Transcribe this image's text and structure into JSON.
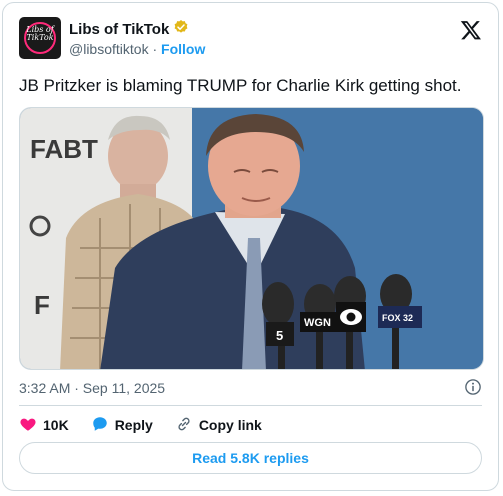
{
  "author": {
    "display_name": "Libs of TikTok",
    "handle": "@libsoftiktok",
    "separator": "·",
    "follow_label": "Follow",
    "avatar_text": "Libs of TikTok"
  },
  "tweet": {
    "text": "JB Pritzker is blaming TRUMP for Charlie Kirk getting shot.",
    "timestamp": "3:32 AM · Sep 11, 2025"
  },
  "media": {
    "backdrop_text_1": "FABT",
    "backdrop_text_2": "F",
    "mic_labels": {
      "nbc": "5",
      "wgn": "WGN",
      "fox": "FOX 32"
    }
  },
  "actions": {
    "likes_count": "10K",
    "reply_label": "Reply",
    "copy_link_label": "Copy link"
  },
  "replies": {
    "button_label": "Read 5.8K replies"
  },
  "colors": {
    "accent": "#1d9bf0",
    "like": "#f91880",
    "verified_gold": "#e2b719",
    "muted": "#536471"
  },
  "icons": [
    "verified-badge-icon",
    "x-logo-icon",
    "info-icon",
    "heart-icon",
    "reply-bubble-icon",
    "link-icon"
  ]
}
